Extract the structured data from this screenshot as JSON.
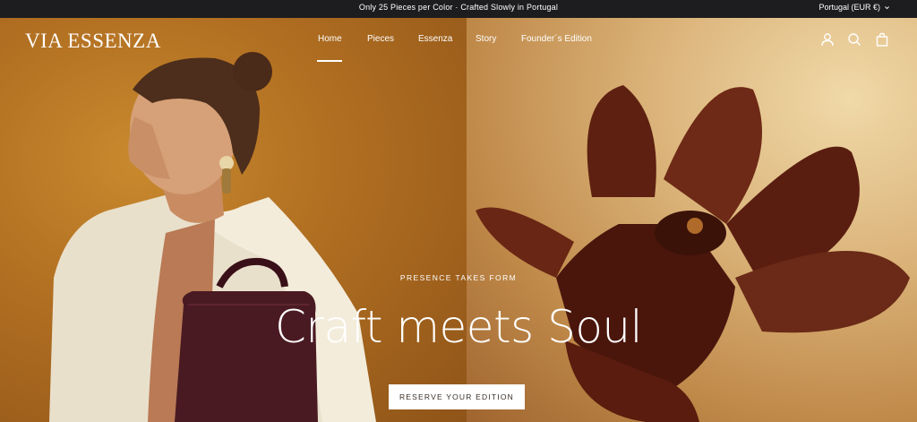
{
  "announcement": {
    "text": "Only 25 Pieces per Color · Crafted Slowly in Portugal"
  },
  "locale": {
    "label": "Portugal (EUR €)",
    "icon": "chevron-down-icon"
  },
  "header": {
    "logo": "VIA ESSENZA",
    "nav": [
      {
        "label": "Home",
        "active": true
      },
      {
        "label": "Pieces"
      },
      {
        "label": "Essenza"
      },
      {
        "label": "Story"
      },
      {
        "label": "Founder´s Edition"
      }
    ],
    "icons": [
      "account-icon",
      "search-icon",
      "cart-icon"
    ]
  },
  "hero": {
    "kicker": "PRESENCE TAKES FORM",
    "headline": "Craft meets Soul",
    "cta": "RESERVE YOUR EDITION"
  },
  "colors": {
    "bar": "#1d1d1f",
    "warm_left": "#b27022",
    "warm_right": "#dcb57c",
    "bag": "#4a1a22",
    "orchid": "#5c1e12"
  }
}
